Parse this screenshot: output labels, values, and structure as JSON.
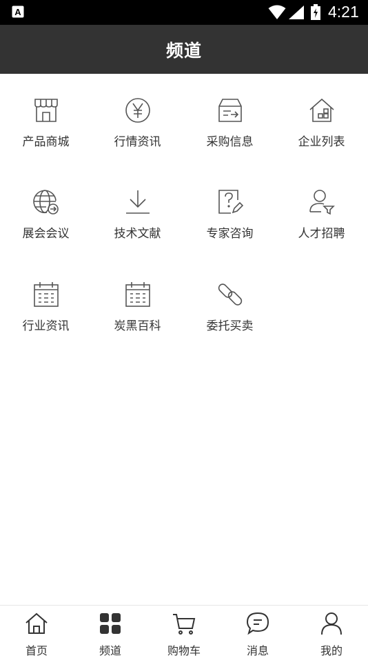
{
  "status_bar": {
    "time": "4:21",
    "app_badge": "A"
  },
  "header": {
    "title": "频道"
  },
  "channels": [
    {
      "label": "产品商城",
      "icon": "store-icon"
    },
    {
      "label": "行情资讯",
      "icon": "yen-icon"
    },
    {
      "label": "采购信息",
      "icon": "purchase-box-icon"
    },
    {
      "label": "企业列表",
      "icon": "company-home-icon"
    },
    {
      "label": "展会会议",
      "icon": "globe-arrow-icon"
    },
    {
      "label": "技术文献",
      "icon": "download-icon"
    },
    {
      "label": "专家咨询",
      "icon": "question-edit-icon"
    },
    {
      "label": "人才招聘",
      "icon": "person-filter-icon"
    },
    {
      "label": "行业资讯",
      "icon": "calendar-icon"
    },
    {
      "label": "炭黑百科",
      "icon": "calendar-icon"
    },
    {
      "label": "委托买卖",
      "icon": "link-icon"
    }
  ],
  "tabbar": [
    {
      "label": "首页",
      "icon": "home-icon"
    },
    {
      "label": "频道",
      "icon": "grid-icon",
      "active": true
    },
    {
      "label": "购物车",
      "icon": "cart-icon"
    },
    {
      "label": "消息",
      "icon": "message-icon"
    },
    {
      "label": "我的",
      "icon": "profile-icon"
    }
  ],
  "colors": {
    "header_bg": "#333333",
    "icon_stroke": "#555555",
    "text": "#333333"
  }
}
